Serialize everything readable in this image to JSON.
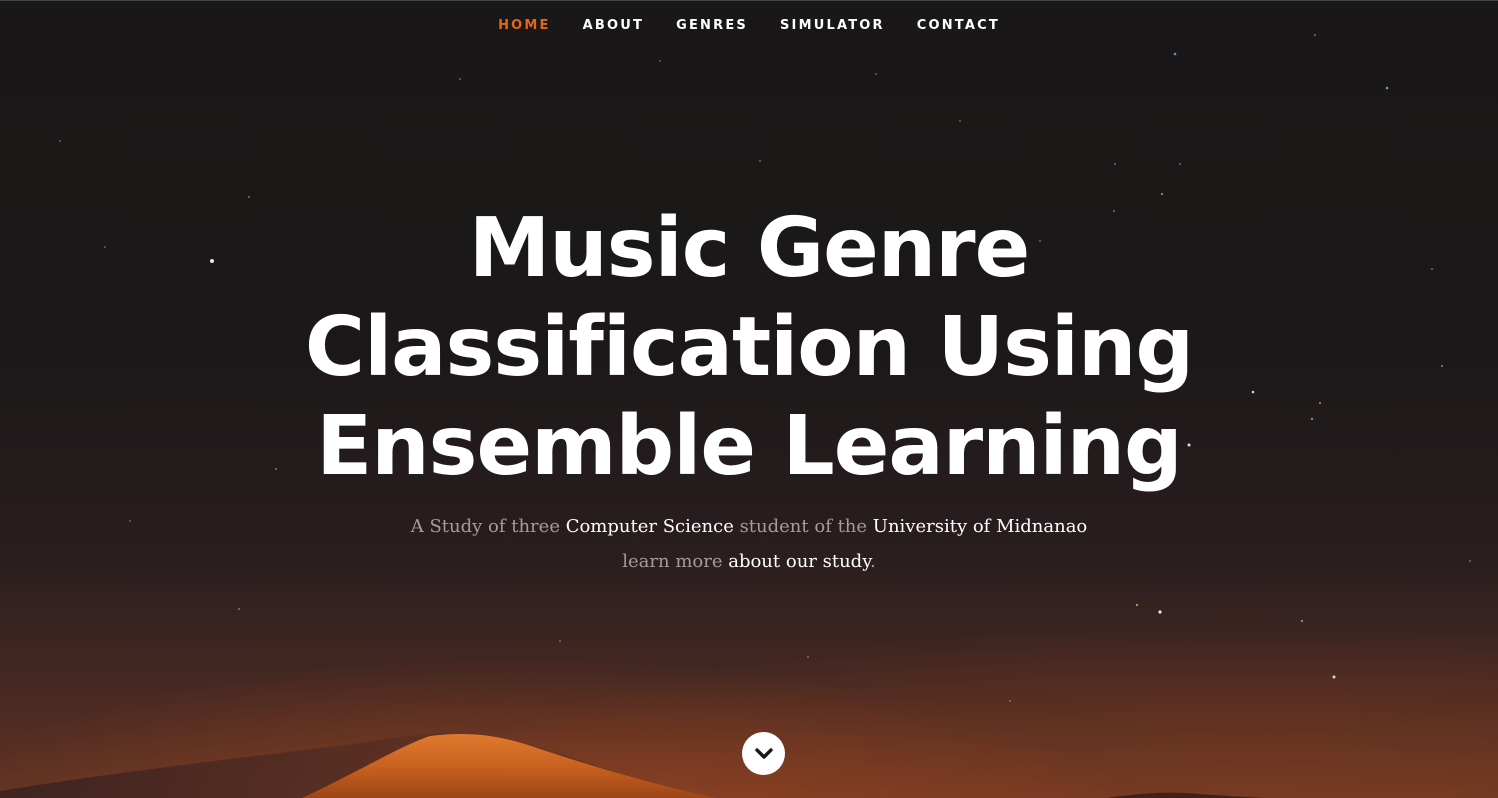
{
  "nav": {
    "items": [
      {
        "label": "HOME",
        "active": true
      },
      {
        "label": "ABOUT",
        "active": false
      },
      {
        "label": "GENRES",
        "active": false
      },
      {
        "label": "SIMULATOR",
        "active": false
      },
      {
        "label": "CONTACT",
        "active": false
      }
    ]
  },
  "hero": {
    "title_lines": [
      "Music Genre",
      "Classification Using",
      "Ensemble Learning"
    ],
    "subtitle_line1": {
      "part1": "A Study of three ",
      "link1": "Computer Science",
      "part2": " student of the ",
      "link2": "University of Midnanao"
    },
    "subtitle_line2": {
      "part1": "learn more ",
      "link": "about our study",
      "part2": "."
    },
    "scroll_icon": "chevron-down-icon"
  },
  "colors": {
    "accent": "#e5651b",
    "text": "#ffffff",
    "muted_text": "#a39d9c",
    "background": "#1b1718"
  }
}
